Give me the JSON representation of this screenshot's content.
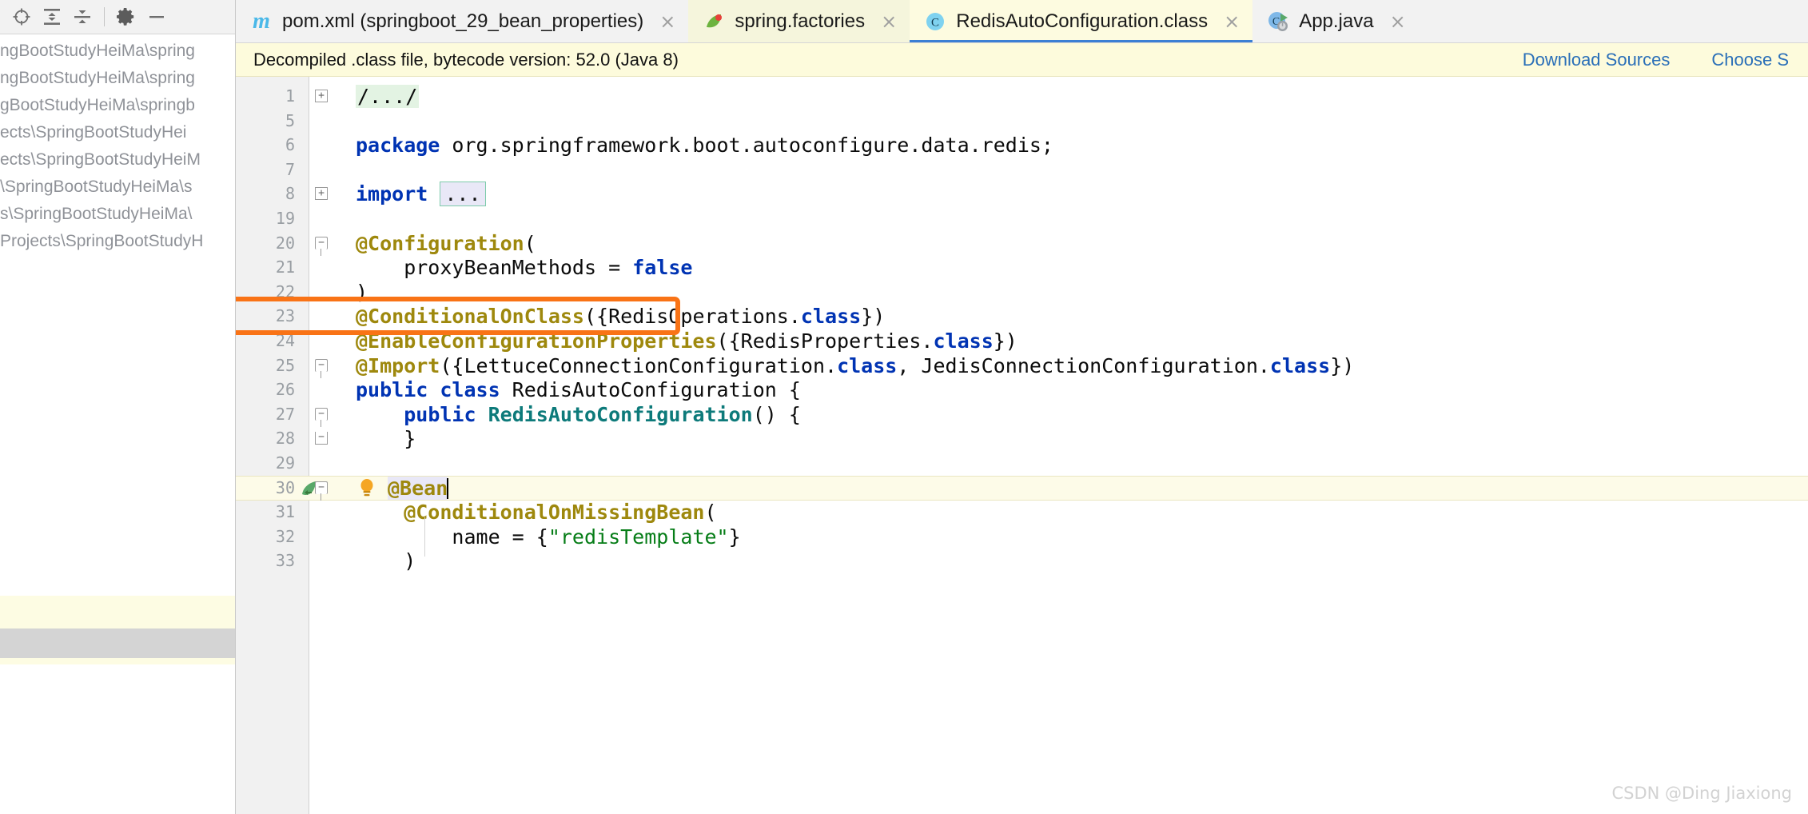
{
  "left_panel": {
    "toolbar": [
      {
        "name": "locate-target-icon",
        "label": "Select Opened File"
      },
      {
        "name": "expand-all-icon",
        "label": "Expand All"
      },
      {
        "name": "collapse-all-icon",
        "label": "Collapse All"
      },
      {
        "name": "settings-gear-icon",
        "label": "Settings"
      },
      {
        "name": "hide-panel-icon",
        "label": "Hide"
      }
    ],
    "paths": [
      "ngBootStudyHeiMa\\spring",
      "ngBootStudyHeiMa\\spring",
      "gBootStudyHeiMa\\springb",
      "ects\\SpringBootStudyHei",
      "ects\\SpringBootStudyHeiM",
      "\\SpringBootStudyHeiMa\\s",
      "s\\SpringBootStudyHeiMa\\",
      "Projects\\SpringBootStudyH"
    ]
  },
  "tabs": [
    {
      "label": "pom.xml (springboot_29_bean_properties)",
      "icon": "maven-m-icon",
      "active": false,
      "close": "×"
    },
    {
      "label": "spring.factories",
      "icon": "spring-leaf-icon",
      "active": false,
      "close": "×"
    },
    {
      "label": "RedisAutoConfiguration.class",
      "icon": "java-class-icon",
      "active": true,
      "close": "×"
    },
    {
      "label": "App.java",
      "icon": "java-class-run-icon",
      "active": false,
      "close": "×"
    }
  ],
  "notice": {
    "text": "Decompiled .class file, bytecode version: 52.0 (Java 8)",
    "links": [
      "Download Sources",
      "Choose S"
    ]
  },
  "code": {
    "lines": [
      {
        "num": "1",
        "fold": "+",
        "segments": [
          {
            "t": "/.../",
            "c": "fold-ph-green"
          }
        ]
      },
      {
        "num": "5",
        "fold": "",
        "segments": []
      },
      {
        "num": "6",
        "fold": "",
        "segments": [
          {
            "t": "package",
            "c": "kw"
          },
          {
            "t": " org.springframework.boot.autoconfigure.data.redis;",
            "c": "plain"
          }
        ]
      },
      {
        "num": "7",
        "fold": "",
        "segments": []
      },
      {
        "num": "8",
        "fold": "+",
        "segments": [
          {
            "t": "import",
            "c": "kw"
          },
          {
            "t": " ",
            "c": "plain"
          },
          {
            "t": "...",
            "c": "fold-ph-imp"
          }
        ]
      },
      {
        "num": "19",
        "fold": "",
        "segments": []
      },
      {
        "num": "20",
        "fold": "-",
        "segments": [
          {
            "t": "@Configuration",
            "c": "ann"
          },
          {
            "t": "(",
            "c": "plain"
          }
        ]
      },
      {
        "num": "21",
        "fold": "",
        "segments": [
          {
            "t": "    proxyBeanMethods = ",
            "c": "plain"
          },
          {
            "t": "false",
            "c": "kw"
          }
        ]
      },
      {
        "num": "22",
        "fold": "",
        "segments": [
          {
            "t": ")",
            "c": "plain"
          }
        ]
      },
      {
        "num": "23",
        "fold": "",
        "segments": [
          {
            "t": "@ConditionalOnClass",
            "c": "ann"
          },
          {
            "t": "({RedisOperations.",
            "c": "plain"
          },
          {
            "t": "class",
            "c": "kw"
          },
          {
            "t": "})",
            "c": "plain"
          }
        ]
      },
      {
        "num": "24",
        "fold": "",
        "segments": [
          {
            "t": "@EnableConfigurationProperties",
            "c": "ann"
          },
          {
            "t": "({RedisProperties.",
            "c": "plain"
          },
          {
            "t": "class",
            "c": "kw"
          },
          {
            "t": "})",
            "c": "plain"
          }
        ]
      },
      {
        "num": "25",
        "fold": "-",
        "segments": [
          {
            "t": "@Import",
            "c": "ann"
          },
          {
            "t": "({LettuceConnectionConfiguration.",
            "c": "plain"
          },
          {
            "t": "class",
            "c": "kw"
          },
          {
            "t": ", JedisConnectionConfiguration.",
            "c": "plain"
          },
          {
            "t": "class",
            "c": "kw"
          },
          {
            "t": "})",
            "c": "plain"
          }
        ]
      },
      {
        "num": "26",
        "fold": "",
        "segments": [
          {
            "t": "public class",
            "c": "kw"
          },
          {
            "t": " RedisAutoConfiguration {",
            "c": "plain"
          }
        ]
      },
      {
        "num": "27",
        "fold": "-",
        "segments": [
          {
            "t": "    ",
            "c": "plain"
          },
          {
            "t": "public",
            "c": "kw"
          },
          {
            "t": " ",
            "c": "plain"
          },
          {
            "t": "RedisAutoConfiguration",
            "c": "ctor"
          },
          {
            "t": "() {",
            "c": "plain"
          }
        ]
      },
      {
        "num": "28",
        "fold": "-e",
        "segments": [
          {
            "t": "    }",
            "c": "plain"
          }
        ]
      },
      {
        "num": "29",
        "fold": "",
        "segments": []
      },
      {
        "num": "30",
        "fold": "-",
        "segments": [
          {
            "t": "@Bean",
            "c": "ann sel-bean"
          }
        ],
        "caret": true,
        "bulb": true,
        "bean_icon": true
      },
      {
        "num": "31",
        "fold": "",
        "segments": [
          {
            "t": "    @ConditionalOnMissingBean",
            "c": "ann"
          },
          {
            "t": "(",
            "c": "plain"
          }
        ]
      },
      {
        "num": "32",
        "fold": "",
        "segments": [
          {
            "t": "        name = {",
            "c": "plain"
          },
          {
            "t": "\"redisTemplate\"",
            "c": "str"
          },
          {
            "t": "}",
            "c": "plain"
          }
        ]
      },
      {
        "num": "33",
        "fold": "",
        "segments": [
          {
            "t": "    )",
            "c": "plain"
          }
        ]
      }
    ],
    "highlight_box": {
      "line_num": "23",
      "color": "#f97316"
    }
  },
  "watermark": "CSDN @Ding Jiaxiong",
  "colors": {
    "accent_blue": "#3c7fd4",
    "annotation_gold": "#9e880d",
    "keyword_blue": "#0033b3",
    "string_green": "#067d17",
    "highlight_orange": "#f97316",
    "notice_bg": "#fdfbdc",
    "active_tab_bg": "#fdfbe0"
  }
}
